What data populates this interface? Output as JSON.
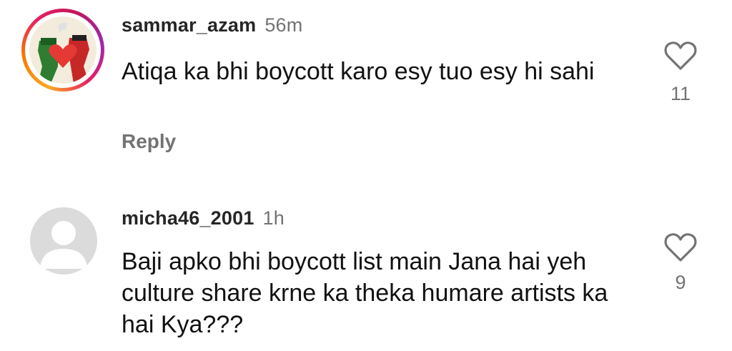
{
  "comments": [
    {
      "username": "sammar_azam",
      "time": "56m",
      "text": "Atiqa ka bhi boycott karo esy tuo esy hi sahi",
      "reply_label": "Reply",
      "likes": "11",
      "avatar": "palestine-heart-artwork",
      "story_ring": true
    },
    {
      "username": "micha46_2001",
      "time": "1h",
      "text": "Baji apko bhi boycott list main Jana hai yeh culture share krne ka theka humare artists ka hai Kya???",
      "likes": "9",
      "avatar": "default-avatar",
      "story_ring": false
    }
  ],
  "colors": {
    "text": "#111111",
    "secondary": "#737373",
    "placeholder_avatar": "#dbdbdb",
    "ring_start": "#f9a825",
    "ring_end": "#c2185b"
  }
}
